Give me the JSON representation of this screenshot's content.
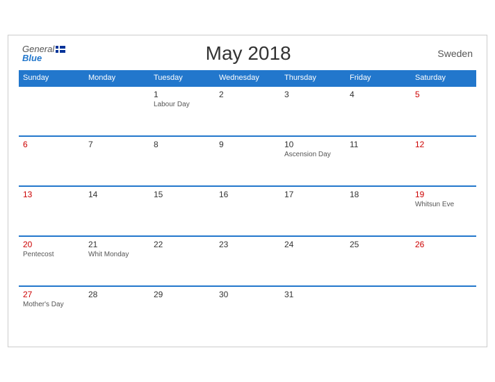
{
  "header": {
    "logo_general": "General",
    "logo_blue": "Blue",
    "title": "May 2018",
    "country": "Sweden"
  },
  "weekdays": [
    "Sunday",
    "Monday",
    "Tuesday",
    "Wednesday",
    "Thursday",
    "Friday",
    "Saturday"
  ],
  "weeks": [
    [
      {
        "day": "",
        "event": "",
        "empty": true,
        "sun": false,
        "sat": false
      },
      {
        "day": "",
        "event": "",
        "empty": true,
        "sun": false,
        "sat": false
      },
      {
        "day": "1",
        "event": "Labour Day",
        "empty": false,
        "sun": false,
        "sat": false
      },
      {
        "day": "2",
        "event": "",
        "empty": false,
        "sun": false,
        "sat": false
      },
      {
        "day": "3",
        "event": "",
        "empty": false,
        "sun": false,
        "sat": false
      },
      {
        "day": "4",
        "event": "",
        "empty": false,
        "sun": false,
        "sat": false
      },
      {
        "day": "5",
        "event": "",
        "empty": false,
        "sun": false,
        "sat": true
      }
    ],
    [
      {
        "day": "6",
        "event": "",
        "empty": false,
        "sun": true,
        "sat": false
      },
      {
        "day": "7",
        "event": "",
        "empty": false,
        "sun": false,
        "sat": false
      },
      {
        "day": "8",
        "event": "",
        "empty": false,
        "sun": false,
        "sat": false
      },
      {
        "day": "9",
        "event": "",
        "empty": false,
        "sun": false,
        "sat": false
      },
      {
        "day": "10",
        "event": "Ascension Day",
        "empty": false,
        "sun": false,
        "sat": false
      },
      {
        "day": "11",
        "event": "",
        "empty": false,
        "sun": false,
        "sat": false
      },
      {
        "day": "12",
        "event": "",
        "empty": false,
        "sun": false,
        "sat": true
      }
    ],
    [
      {
        "day": "13",
        "event": "",
        "empty": false,
        "sun": true,
        "sat": false
      },
      {
        "day": "14",
        "event": "",
        "empty": false,
        "sun": false,
        "sat": false
      },
      {
        "day": "15",
        "event": "",
        "empty": false,
        "sun": false,
        "sat": false
      },
      {
        "day": "16",
        "event": "",
        "empty": false,
        "sun": false,
        "sat": false
      },
      {
        "day": "17",
        "event": "",
        "empty": false,
        "sun": false,
        "sat": false
      },
      {
        "day": "18",
        "event": "",
        "empty": false,
        "sun": false,
        "sat": false
      },
      {
        "day": "19",
        "event": "Whitsun Eve",
        "empty": false,
        "sun": false,
        "sat": true
      }
    ],
    [
      {
        "day": "20",
        "event": "Pentecost",
        "empty": false,
        "sun": true,
        "sat": false
      },
      {
        "day": "21",
        "event": "Whit Monday",
        "empty": false,
        "sun": false,
        "sat": false
      },
      {
        "day": "22",
        "event": "",
        "empty": false,
        "sun": false,
        "sat": false
      },
      {
        "day": "23",
        "event": "",
        "empty": false,
        "sun": false,
        "sat": false
      },
      {
        "day": "24",
        "event": "",
        "empty": false,
        "sun": false,
        "sat": false
      },
      {
        "day": "25",
        "event": "",
        "empty": false,
        "sun": false,
        "sat": false
      },
      {
        "day": "26",
        "event": "",
        "empty": false,
        "sun": false,
        "sat": true
      }
    ],
    [
      {
        "day": "27",
        "event": "Mother's Day",
        "empty": false,
        "sun": true,
        "sat": false
      },
      {
        "day": "28",
        "event": "",
        "empty": false,
        "sun": false,
        "sat": false
      },
      {
        "day": "29",
        "event": "",
        "empty": false,
        "sun": false,
        "sat": false
      },
      {
        "day": "30",
        "event": "",
        "empty": false,
        "sun": false,
        "sat": false
      },
      {
        "day": "31",
        "event": "",
        "empty": false,
        "sun": false,
        "sat": false
      },
      {
        "day": "",
        "event": "",
        "empty": true,
        "sun": false,
        "sat": false
      },
      {
        "day": "",
        "event": "",
        "empty": true,
        "sun": false,
        "sat": false
      }
    ]
  ]
}
